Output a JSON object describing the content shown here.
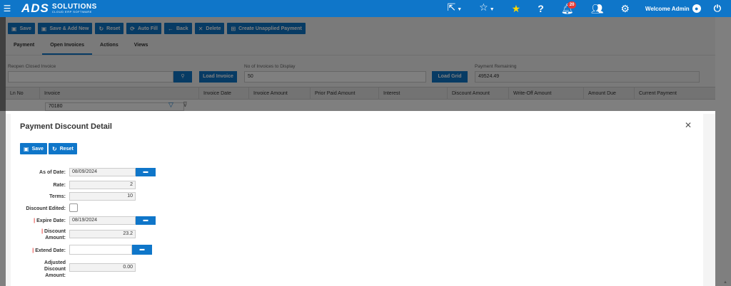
{
  "header": {
    "logo_brand": "ADS",
    "logo_name": "SOLUTIONS",
    "logo_tagline": "CLOUD ERP SOFTWARE",
    "notification_count": "20",
    "welcome_text": "Welcome Admin"
  },
  "toolbar": {
    "save": "Save",
    "save_add_new": "Save & Add New",
    "reset": "Reset",
    "auto_fill": "Auto Fill",
    "back": "Back",
    "delete": "Delete",
    "create_unapplied": "Create Unapplied Payment"
  },
  "tabs": [
    "Payment",
    "Open Invoices",
    "Actions",
    "Views"
  ],
  "filters": {
    "reopen_label": "Reopen Closed Invoice",
    "reopen_value": "",
    "load_invoice": "Load Invoice",
    "num_invoices_label": "No of Invoices to Display",
    "num_invoices_value": "50",
    "load_grid": "Load Grid",
    "payment_remaining_label": "Payment Remaining",
    "payment_remaining_value": "49524.49"
  },
  "grid": {
    "columns": [
      "Ln No",
      "Invoice",
      "Invoice Date",
      "Invoice Amount",
      "Prior Paid Amount",
      "Interest",
      "Discount Amount",
      "Write-Off Amount",
      "Amount Due",
      "Current Payment"
    ],
    "row_invoice": "70180"
  },
  "modal": {
    "title": "Payment Discount Detail",
    "save": "Save",
    "reset": "Reset",
    "fields": {
      "as_of_date_label": "As of Date:",
      "as_of_date_value": "08/09/2024",
      "rate_label": "Rate:",
      "rate_value": "2",
      "terms_label": "Terms:",
      "terms_value": "10",
      "discount_edited_label": "Discount Edited:",
      "expire_date_label": "Expire Date:",
      "expire_date_value": "08/19/2024",
      "discount_amount_label_1": "Discount",
      "discount_amount_label_2": "Amount:",
      "discount_amount_value": "23.2",
      "extend_date_label": "Extend Date:",
      "extend_date_value": "",
      "adjusted_label_1": "Adjusted",
      "adjusted_label_2": "Discount",
      "adjusted_label_3": "Amount:",
      "adjusted_value": "0.00"
    }
  },
  "colors": {
    "primary": "#0f76c9",
    "star": "#ffd700",
    "badge": "#e53935"
  }
}
